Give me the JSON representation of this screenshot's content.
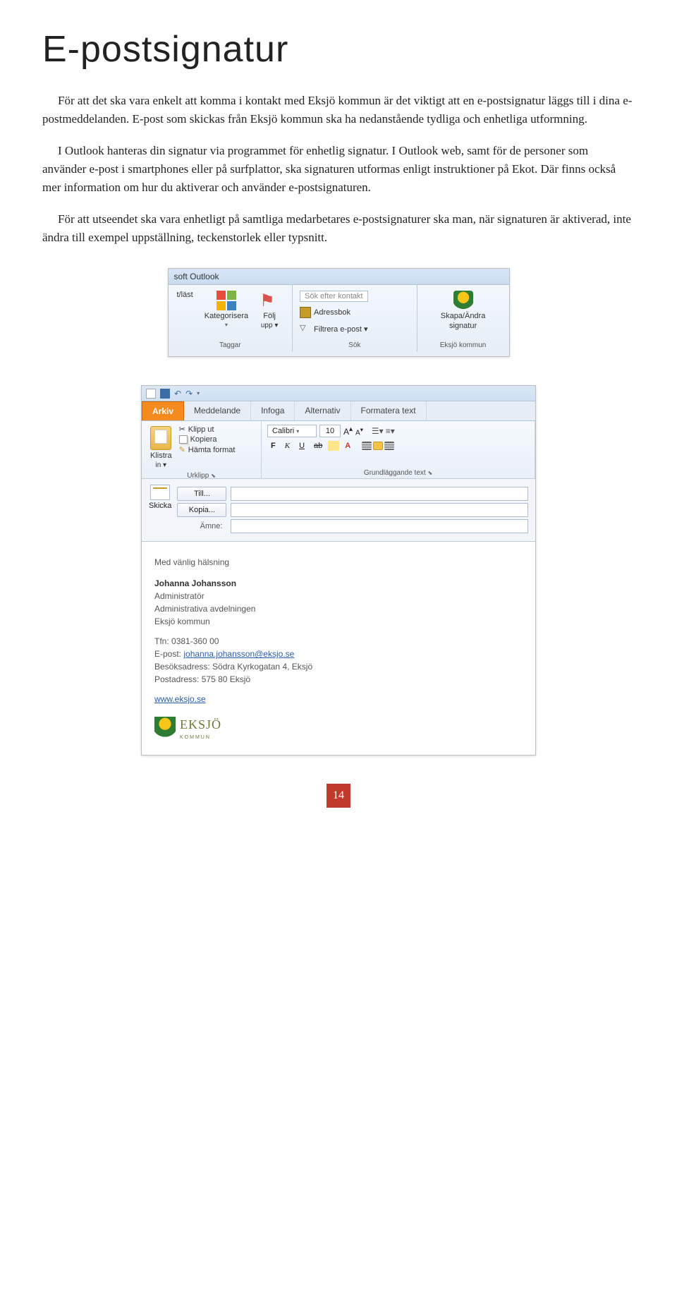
{
  "title": "E-postsignatur",
  "para1": "För att det ska vara enkelt att komma i kontakt med Eksjö kommun är det viktigt att en e-postsignatur läggs till i dina e-postmeddelanden. E-post som skickas från Eksjö kommun ska ha nedanstående tydliga och enhetliga utformning.",
  "para2": "I Outlook hanteras din signatur via programmet för enhetlig signatur. I Outlook web, samt för de personer som använder e-post i smartphones eller på surfplattor, ska signaturen utformas enligt instruktioner på Ekot. Där finns också mer information om hur du aktiverar och använder e-postsignaturen.",
  "para3": "För att utseendet ska vara enhetligt på samtliga medarbetares e-postsignaturer ska man, när signaturen är aktiverad, inte ändra till exempel uppställning, teckenstorlek eller typsnitt.",
  "shot1": {
    "titlebar": "soft Outlook",
    "btn_readmark": "t/läst",
    "btn_categorize": "Kategorisera",
    "btn_follow": "Följ",
    "btn_follow_sub": "upp ▾",
    "group_tags": "Taggar",
    "search_contact": "Sök efter kontakt",
    "addressbook": "Adressbok",
    "filter": "Filtrera e-post ▾",
    "group_search": "Sök",
    "create_sig": "Skapa/Ändra",
    "create_sig2": "signatur",
    "group_eksjo": "Eksjö kommun"
  },
  "shot2": {
    "tabs": {
      "arkiv": "Arkiv",
      "meddelande": "Meddelande",
      "infoga": "Infoga",
      "alternativ": "Alternativ",
      "formatera": "Formatera text"
    },
    "paste": "Klistra",
    "paste_sub": "in ▾",
    "cut": "Klipp ut",
    "copy": "Kopiera",
    "fmtpaint": "Hämta format",
    "group_clipboard": "Urklipp",
    "font_name": "Calibri",
    "font_size": "10",
    "group_font": "Grundläggande text",
    "to": "Till...",
    "cc": "Kopia...",
    "subject": "Ämne:",
    "send": "Skicka",
    "sig": {
      "greet": "Med vänlig hälsning",
      "name": "Johanna Johansson",
      "role": "Administratör",
      "dept": "Administrativa avdelningen",
      "org": "Eksjö kommun",
      "phone_lbl": "Tfn:",
      "phone": "0381-360 00",
      "email_lbl": "E-post:",
      "email": "johanna.johansson@eksjo.se",
      "visit_lbl": "Besöksadress:",
      "visit": "Södra Kyrkogatan 4, Eksjö",
      "post_lbl": "Postadress:",
      "post": "575 80 Eksjö",
      "url": "www.eksjo.se",
      "logo_text": "EKSJÖ",
      "logo_sub": "KOMMUN"
    }
  },
  "page_number": "14"
}
